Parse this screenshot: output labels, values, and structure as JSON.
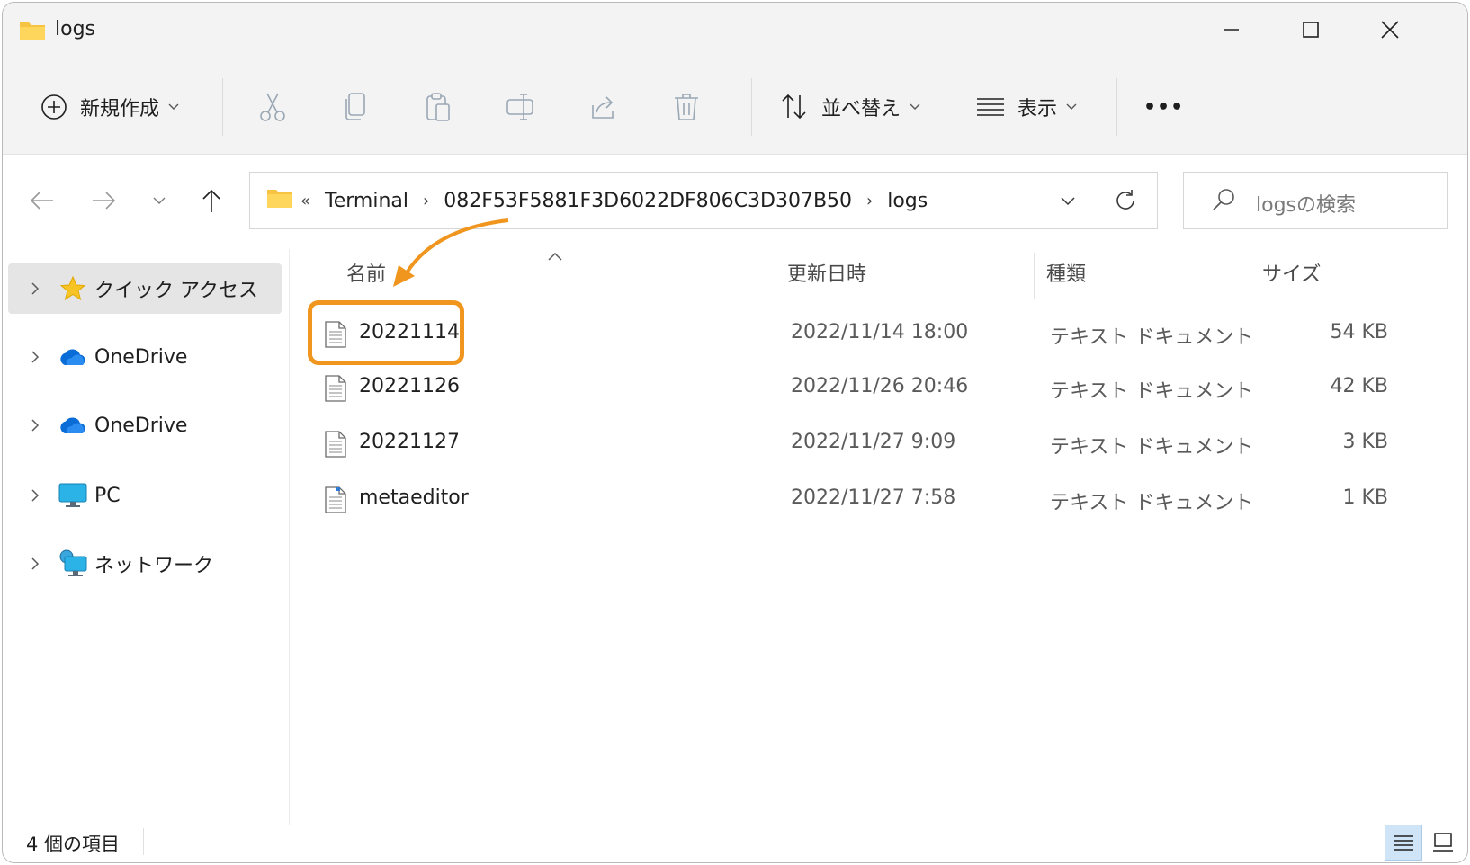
{
  "window": {
    "title": "logs"
  },
  "toolbar": {
    "new_label": "新規作成",
    "sort_label": "並べ替え",
    "view_label": "表示",
    "more_label": "•••"
  },
  "address": {
    "overflow": "«",
    "crumbs": [
      "Terminal",
      "082F53F5881F3D6022DF806C3D307B50",
      "logs"
    ]
  },
  "search": {
    "placeholder": "logsの検索"
  },
  "sidebar": {
    "items": [
      {
        "label": "クイック アクセス",
        "icon": "star-icon"
      },
      {
        "label": "OneDrive",
        "icon": "cloud-icon"
      },
      {
        "label": "OneDrive",
        "icon": "cloud-icon"
      },
      {
        "label": "PC",
        "icon": "monitor-icon"
      },
      {
        "label": "ネットワーク",
        "icon": "network-icon"
      }
    ]
  },
  "columns": {
    "name": "名前",
    "modified": "更新日時",
    "type": "種類",
    "size": "サイズ"
  },
  "files": [
    {
      "name": "20221114",
      "modified": "2022/11/14 18:00",
      "type": "テキスト ドキュメント",
      "size": "54 KB"
    },
    {
      "name": "20221126",
      "modified": "2022/11/26 20:46",
      "type": "テキスト ドキュメント",
      "size": "42 KB"
    },
    {
      "name": "20221127",
      "modified": "2022/11/27 9:09",
      "type": "テキスト ドキュメント",
      "size": "3 KB"
    },
    {
      "name": "metaeditor",
      "modified": "2022/11/27 7:58",
      "type": "テキスト ドキュメント",
      "size": "1 KB"
    }
  ],
  "status": {
    "item_count": "4 個の項目"
  },
  "colors": {
    "highlight": "#f0951e",
    "folder": "#f6c343",
    "selection": "#e5e5e5"
  }
}
